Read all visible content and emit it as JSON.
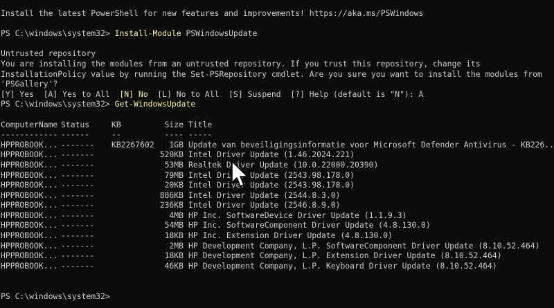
{
  "terminal": {
    "banner": "Install the latest PowerShell for new features and improvements! https://aka.ms/PSWindows",
    "prompt": "PS C:\\windows\\system32> ",
    "command1": "Install-Module",
    "command1_args": " PSWindowsUpdate",
    "untrusted_title": "Untrusted repository",
    "untrusted_line1": "You are installing the modules from an untrusted repository. If you trust this repository, change its",
    "untrusted_line2": "InstallationPolicy value by running the Set-PSRepository cmdlet. Are you sure you want to install the modules from",
    "untrusted_line3": "'PSGallery'?",
    "choice_options": "[Y] Yes  [A] Yes to All  ",
    "choice_no": "[N] No",
    "choice_rest": "  [L] No to All  [S] Suspend  [?] Help (default is \"N\"): A",
    "command2": "Get-WindowsUpdate",
    "final_prompt": "PS C:\\windows\\system32>"
  },
  "table": {
    "headers": {
      "computer": "ComputerName",
      "status": "Status",
      "kb": "KB",
      "size": "Size",
      "title": "Title"
    },
    "separators": {
      "computer": "------------",
      "status": "------",
      "kb": "--",
      "size": "----",
      "title": "-----"
    },
    "rows": [
      {
        "computer": "HPPROBOOK...",
        "status": "-------",
        "kb": "KB2267602",
        "size": "1GB",
        "title": "Update van beveiligingsinformatie voor Microsoft Defender Antivirus - KB226..."
      },
      {
        "computer": "HPPROBOOK...",
        "status": "-------",
        "kb": "",
        "size": "520KB",
        "title": "Intel Driver Update (1.46.2024.221)"
      },
      {
        "computer": "HPPROBOOK...",
        "status": "-------",
        "kb": "",
        "size": "53MB",
        "title": "Realtek Driver Update (10.0.22000.20390)"
      },
      {
        "computer": "HPPROBOOK...",
        "status": "-------",
        "kb": "",
        "size": "79MB",
        "title": "Intel Driver Update (2543.98.178.0)"
      },
      {
        "computer": "HPPROBOOK...",
        "status": "-------",
        "kb": "",
        "size": "20KB",
        "title": "Intel Driver Update (2543.98.178.0)"
      },
      {
        "computer": "HPPROBOOK...",
        "status": "-------",
        "kb": "",
        "size": "886KB",
        "title": "Intel Driver Update (2544.8.3.0)"
      },
      {
        "computer": "HPPROBOOK...",
        "status": "-------",
        "kb": "",
        "size": "236KB",
        "title": "Intel Driver Update (2546.8.9.0)"
      },
      {
        "computer": "HPPROBOOK...",
        "status": "-------",
        "kb": "",
        "size": "4MB",
        "title": "HP Inc. SoftwareDevice Driver Update (1.1.9.3)"
      },
      {
        "computer": "HPPROBOOK...",
        "status": "-------",
        "kb": "",
        "size": "54MB",
        "title": "HP Inc. SoftwareComponent Driver Update (4.8.130.0)"
      },
      {
        "computer": "HPPROBOOK...",
        "status": "-------",
        "kb": "",
        "size": "18KB",
        "title": "HP Inc. Extension Driver Update (4.8.130.0)"
      },
      {
        "computer": "HPPROBOOK...",
        "status": "-------",
        "kb": "",
        "size": "2MB",
        "title": "HP Development Company, L.P. SoftwareComponent Driver Update (8.10.52.464)"
      },
      {
        "computer": "HPPROBOOK...",
        "status": "-------",
        "kb": "",
        "size": "18KB",
        "title": "HP Development Company, L.P. Extension Driver Update (8.10.52.464)"
      },
      {
        "computer": "HPPROBOOK...",
        "status": "-------",
        "kb": "",
        "size": "46KB",
        "title": "HP Development Company, L.P. Keyboard Driver Update (8.10.52.464)"
      }
    ]
  },
  "colors": {
    "background": "#0c0c0c",
    "text": "#cccccc",
    "command": "#f9f1a5"
  },
  "icons": {
    "cursor": "mouse-pointer-icon"
  }
}
